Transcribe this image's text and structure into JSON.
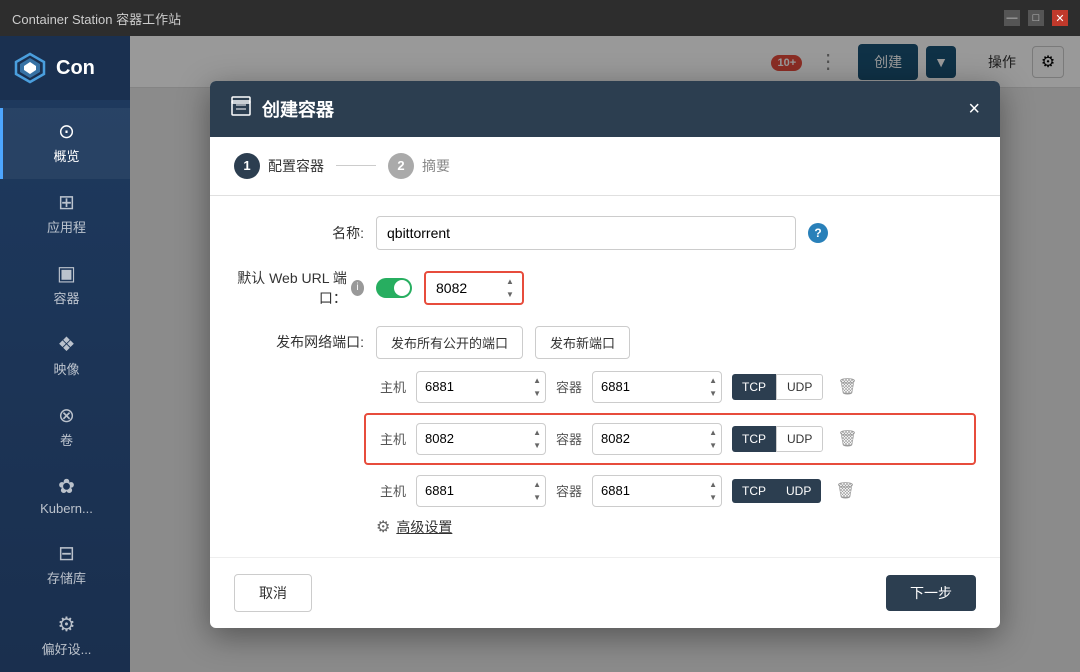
{
  "app": {
    "title": "Container Station 容器工作站",
    "logo_text": "Con"
  },
  "titlebar": {
    "minimize": "—",
    "maximize": "□",
    "close": "✕"
  },
  "sidebar": {
    "items": [
      {
        "id": "overview",
        "label": "概览",
        "icon": "○"
      },
      {
        "id": "apps",
        "label": "应用程",
        "icon": "⊞"
      },
      {
        "id": "containers",
        "label": "容器",
        "icon": "◻"
      },
      {
        "id": "images",
        "label": "映像",
        "icon": "◈"
      },
      {
        "id": "volumes",
        "label": "卷",
        "icon": "⊛"
      },
      {
        "id": "kubernetes",
        "label": "Kubern...",
        "icon": "✿"
      },
      {
        "id": "storage",
        "label": "存储库",
        "icon": "⊟"
      },
      {
        "id": "prefs",
        "label": "偏好设...",
        "icon": "⚙"
      }
    ]
  },
  "topbar": {
    "action_label": "操作",
    "create_label": "创建",
    "notification_count": "10+"
  },
  "dialog": {
    "title": "创建容器",
    "close_btn": "×",
    "steps": [
      {
        "number": "1",
        "label": "配置容器",
        "active": true
      },
      {
        "number": "2",
        "label": "摘要",
        "active": false
      }
    ],
    "form": {
      "name_label": "名称:",
      "name_value": "qbittorrent",
      "web_url_label": "默认 Web URL 端口：",
      "web_url_port": "8082",
      "net_port_label": "发布网络端口:",
      "publish_all_label": "发布所有公开的端口",
      "publish_new_label": "发布新端口",
      "port_rows": [
        {
          "host_label": "主机",
          "host_value": "6881",
          "container_label": "容器",
          "container_value": "6881",
          "tcp": "TCP",
          "udp": "UDP",
          "udp_active": false,
          "highlighted": false
        },
        {
          "host_label": "主机",
          "host_value": "8082",
          "container_label": "容器",
          "container_value": "8082",
          "tcp": "TCP",
          "udp": "UDP",
          "udp_active": false,
          "highlighted": true
        },
        {
          "host_label": "主机",
          "host_value": "6881",
          "container_label": "容器",
          "container_value": "6881",
          "tcp": "TCP",
          "udp": "UDP",
          "udp_active": true,
          "highlighted": false
        }
      ],
      "advanced_label": "高级设置"
    },
    "footer": {
      "cancel_label": "取消",
      "next_label": "下一步"
    }
  }
}
